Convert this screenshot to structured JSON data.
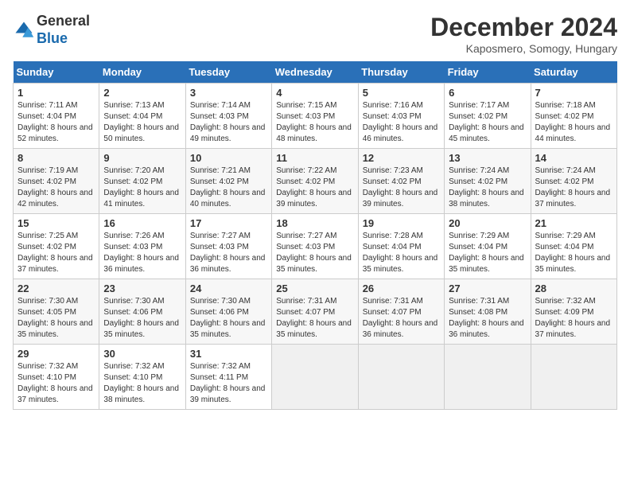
{
  "logo": {
    "general": "General",
    "blue": "Blue"
  },
  "header": {
    "month": "December 2024",
    "location": "Kaposmero, Somogy, Hungary"
  },
  "weekdays": [
    "Sunday",
    "Monday",
    "Tuesday",
    "Wednesday",
    "Thursday",
    "Friday",
    "Saturday"
  ],
  "weeks": [
    [
      {
        "day": "1",
        "sunrise": "7:11 AM",
        "sunset": "4:04 PM",
        "daylight": "8 hours and 52 minutes."
      },
      {
        "day": "2",
        "sunrise": "7:13 AM",
        "sunset": "4:04 PM",
        "daylight": "8 hours and 50 minutes."
      },
      {
        "day": "3",
        "sunrise": "7:14 AM",
        "sunset": "4:03 PM",
        "daylight": "8 hours and 49 minutes."
      },
      {
        "day": "4",
        "sunrise": "7:15 AM",
        "sunset": "4:03 PM",
        "daylight": "8 hours and 48 minutes."
      },
      {
        "day": "5",
        "sunrise": "7:16 AM",
        "sunset": "4:03 PM",
        "daylight": "8 hours and 46 minutes."
      },
      {
        "day": "6",
        "sunrise": "7:17 AM",
        "sunset": "4:02 PM",
        "daylight": "8 hours and 45 minutes."
      },
      {
        "day": "7",
        "sunrise": "7:18 AM",
        "sunset": "4:02 PM",
        "daylight": "8 hours and 44 minutes."
      }
    ],
    [
      {
        "day": "8",
        "sunrise": "7:19 AM",
        "sunset": "4:02 PM",
        "daylight": "8 hours and 42 minutes."
      },
      {
        "day": "9",
        "sunrise": "7:20 AM",
        "sunset": "4:02 PM",
        "daylight": "8 hours and 41 minutes."
      },
      {
        "day": "10",
        "sunrise": "7:21 AM",
        "sunset": "4:02 PM",
        "daylight": "8 hours and 40 minutes."
      },
      {
        "day": "11",
        "sunrise": "7:22 AM",
        "sunset": "4:02 PM",
        "daylight": "8 hours and 39 minutes."
      },
      {
        "day": "12",
        "sunrise": "7:23 AM",
        "sunset": "4:02 PM",
        "daylight": "8 hours and 39 minutes."
      },
      {
        "day": "13",
        "sunrise": "7:24 AM",
        "sunset": "4:02 PM",
        "daylight": "8 hours and 38 minutes."
      },
      {
        "day": "14",
        "sunrise": "7:24 AM",
        "sunset": "4:02 PM",
        "daylight": "8 hours and 37 minutes."
      }
    ],
    [
      {
        "day": "15",
        "sunrise": "7:25 AM",
        "sunset": "4:02 PM",
        "daylight": "8 hours and 37 minutes."
      },
      {
        "day": "16",
        "sunrise": "7:26 AM",
        "sunset": "4:03 PM",
        "daylight": "8 hours and 36 minutes."
      },
      {
        "day": "17",
        "sunrise": "7:27 AM",
        "sunset": "4:03 PM",
        "daylight": "8 hours and 36 minutes."
      },
      {
        "day": "18",
        "sunrise": "7:27 AM",
        "sunset": "4:03 PM",
        "daylight": "8 hours and 35 minutes."
      },
      {
        "day": "19",
        "sunrise": "7:28 AM",
        "sunset": "4:04 PM",
        "daylight": "8 hours and 35 minutes."
      },
      {
        "day": "20",
        "sunrise": "7:29 AM",
        "sunset": "4:04 PM",
        "daylight": "8 hours and 35 minutes."
      },
      {
        "day": "21",
        "sunrise": "7:29 AM",
        "sunset": "4:04 PM",
        "daylight": "8 hours and 35 minutes."
      }
    ],
    [
      {
        "day": "22",
        "sunrise": "7:30 AM",
        "sunset": "4:05 PM",
        "daylight": "8 hours and 35 minutes."
      },
      {
        "day": "23",
        "sunrise": "7:30 AM",
        "sunset": "4:06 PM",
        "daylight": "8 hours and 35 minutes."
      },
      {
        "day": "24",
        "sunrise": "7:30 AM",
        "sunset": "4:06 PM",
        "daylight": "8 hours and 35 minutes."
      },
      {
        "day": "25",
        "sunrise": "7:31 AM",
        "sunset": "4:07 PM",
        "daylight": "8 hours and 35 minutes."
      },
      {
        "day": "26",
        "sunrise": "7:31 AM",
        "sunset": "4:07 PM",
        "daylight": "8 hours and 36 minutes."
      },
      {
        "day": "27",
        "sunrise": "7:31 AM",
        "sunset": "4:08 PM",
        "daylight": "8 hours and 36 minutes."
      },
      {
        "day": "28",
        "sunrise": "7:32 AM",
        "sunset": "4:09 PM",
        "daylight": "8 hours and 37 minutes."
      }
    ],
    [
      {
        "day": "29",
        "sunrise": "7:32 AM",
        "sunset": "4:10 PM",
        "daylight": "8 hours and 37 minutes."
      },
      {
        "day": "30",
        "sunrise": "7:32 AM",
        "sunset": "4:10 PM",
        "daylight": "8 hours and 38 minutes."
      },
      {
        "day": "31",
        "sunrise": "7:32 AM",
        "sunset": "4:11 PM",
        "daylight": "8 hours and 39 minutes."
      },
      null,
      null,
      null,
      null
    ]
  ]
}
